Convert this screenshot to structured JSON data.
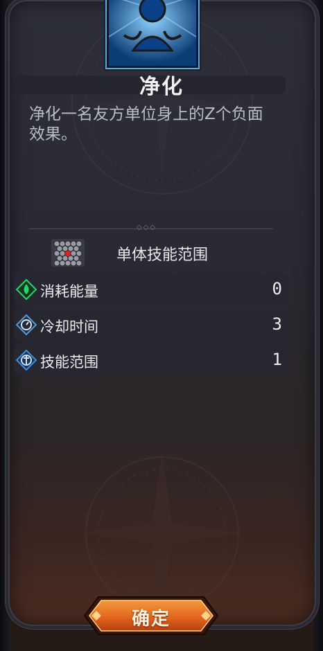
{
  "skill": {
    "name": "净化",
    "description": "净化一名友方单位身上的Z个负面效果。",
    "portrait_icon": "purify-portrait-icon"
  },
  "range": {
    "label": "单体技能范围",
    "icon": "hex-grid-range-icon"
  },
  "stats": [
    {
      "label": "消耗能量",
      "value": "0",
      "icon": "energy-drop-icon",
      "color": "#2fd36a"
    },
    {
      "label": "冷却时间",
      "value": "3",
      "icon": "cooldown-clock-icon",
      "color": "#5b9ad6"
    },
    {
      "label": "技能范围",
      "value": "1",
      "icon": "range-target-icon",
      "color": "#3d8fe0"
    }
  ],
  "confirm_button": {
    "label": "确定"
  },
  "colors": {
    "panel": "#2a2a33",
    "accent_orange": "#e2661f",
    "text": "#eceef3"
  }
}
